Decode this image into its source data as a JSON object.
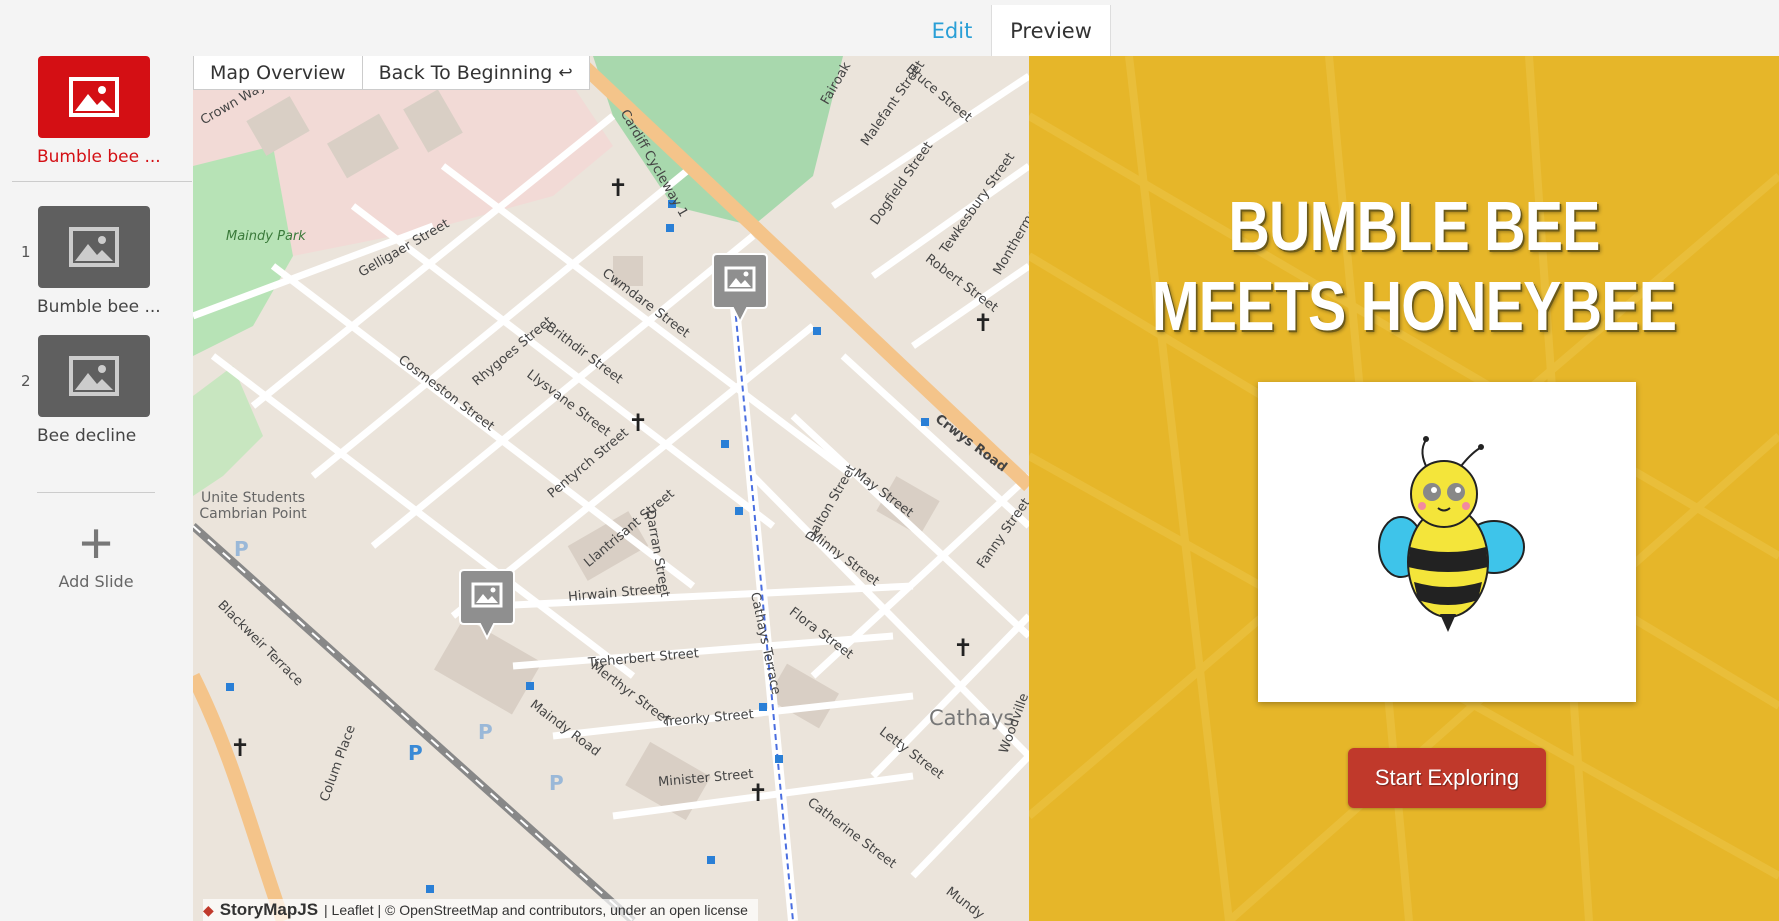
{
  "tabs": {
    "edit": "Edit",
    "preview": "Preview"
  },
  "sidebar": {
    "title_slide_label": "Bumble bee ...",
    "slides": [
      {
        "number": "1",
        "label": "Bumble bee ..."
      },
      {
        "number": "2",
        "label": "Bee decline"
      }
    ],
    "add_slide": "Add Slide"
  },
  "map": {
    "overview_button": "Map Overview",
    "back_button": "Back To Beginning",
    "credit_brand": "StoryMapJS",
    "credit_text": "| Leaflet | © OpenStreetMap and contributors, under an open license",
    "streets": [
      "Crown Way",
      "Maindy Park",
      "Gelligaer Street",
      "Cosmeston Street",
      "Rhygoes Street",
      "Brithdir Street",
      "Cwmdare Street",
      "Llysvane Street",
      "Pentyrch Street",
      "Llantrisant Street",
      "Darran Street",
      "Hirwain Street",
      "Treherbert Street",
      "Treorky Street",
      "Minister Street",
      "Merthyr Street",
      "Maindy Road",
      "Cathays Terrace",
      "Flora Street",
      "Minny Street",
      "May Street",
      "Dalton Street",
      "Crwys Road",
      "Fanny Street",
      "Letty Street",
      "Catherine Street",
      "Colum Place",
      "Blackweir Terrace",
      "Unite Students Cambrian Point",
      "Cathays",
      "Cardiff Cycleway 1",
      "Fairoak",
      "Malefant Street",
      "Bruce Street",
      "Dogfield Street",
      "Tewkesbury Street",
      "Robert Street",
      "Monthermer Road",
      "Woodville",
      "Mundy"
    ]
  },
  "slide": {
    "title": "BUMBLE BEE MEETS HONEYBEE",
    "button": "Start Exploring",
    "background_color": "#e6b629",
    "button_color": "#c0392b"
  },
  "colors": {
    "accent": "#2a9fd6",
    "active_slide": "#d40f14",
    "inactive_slide": "#5f5f5f"
  }
}
